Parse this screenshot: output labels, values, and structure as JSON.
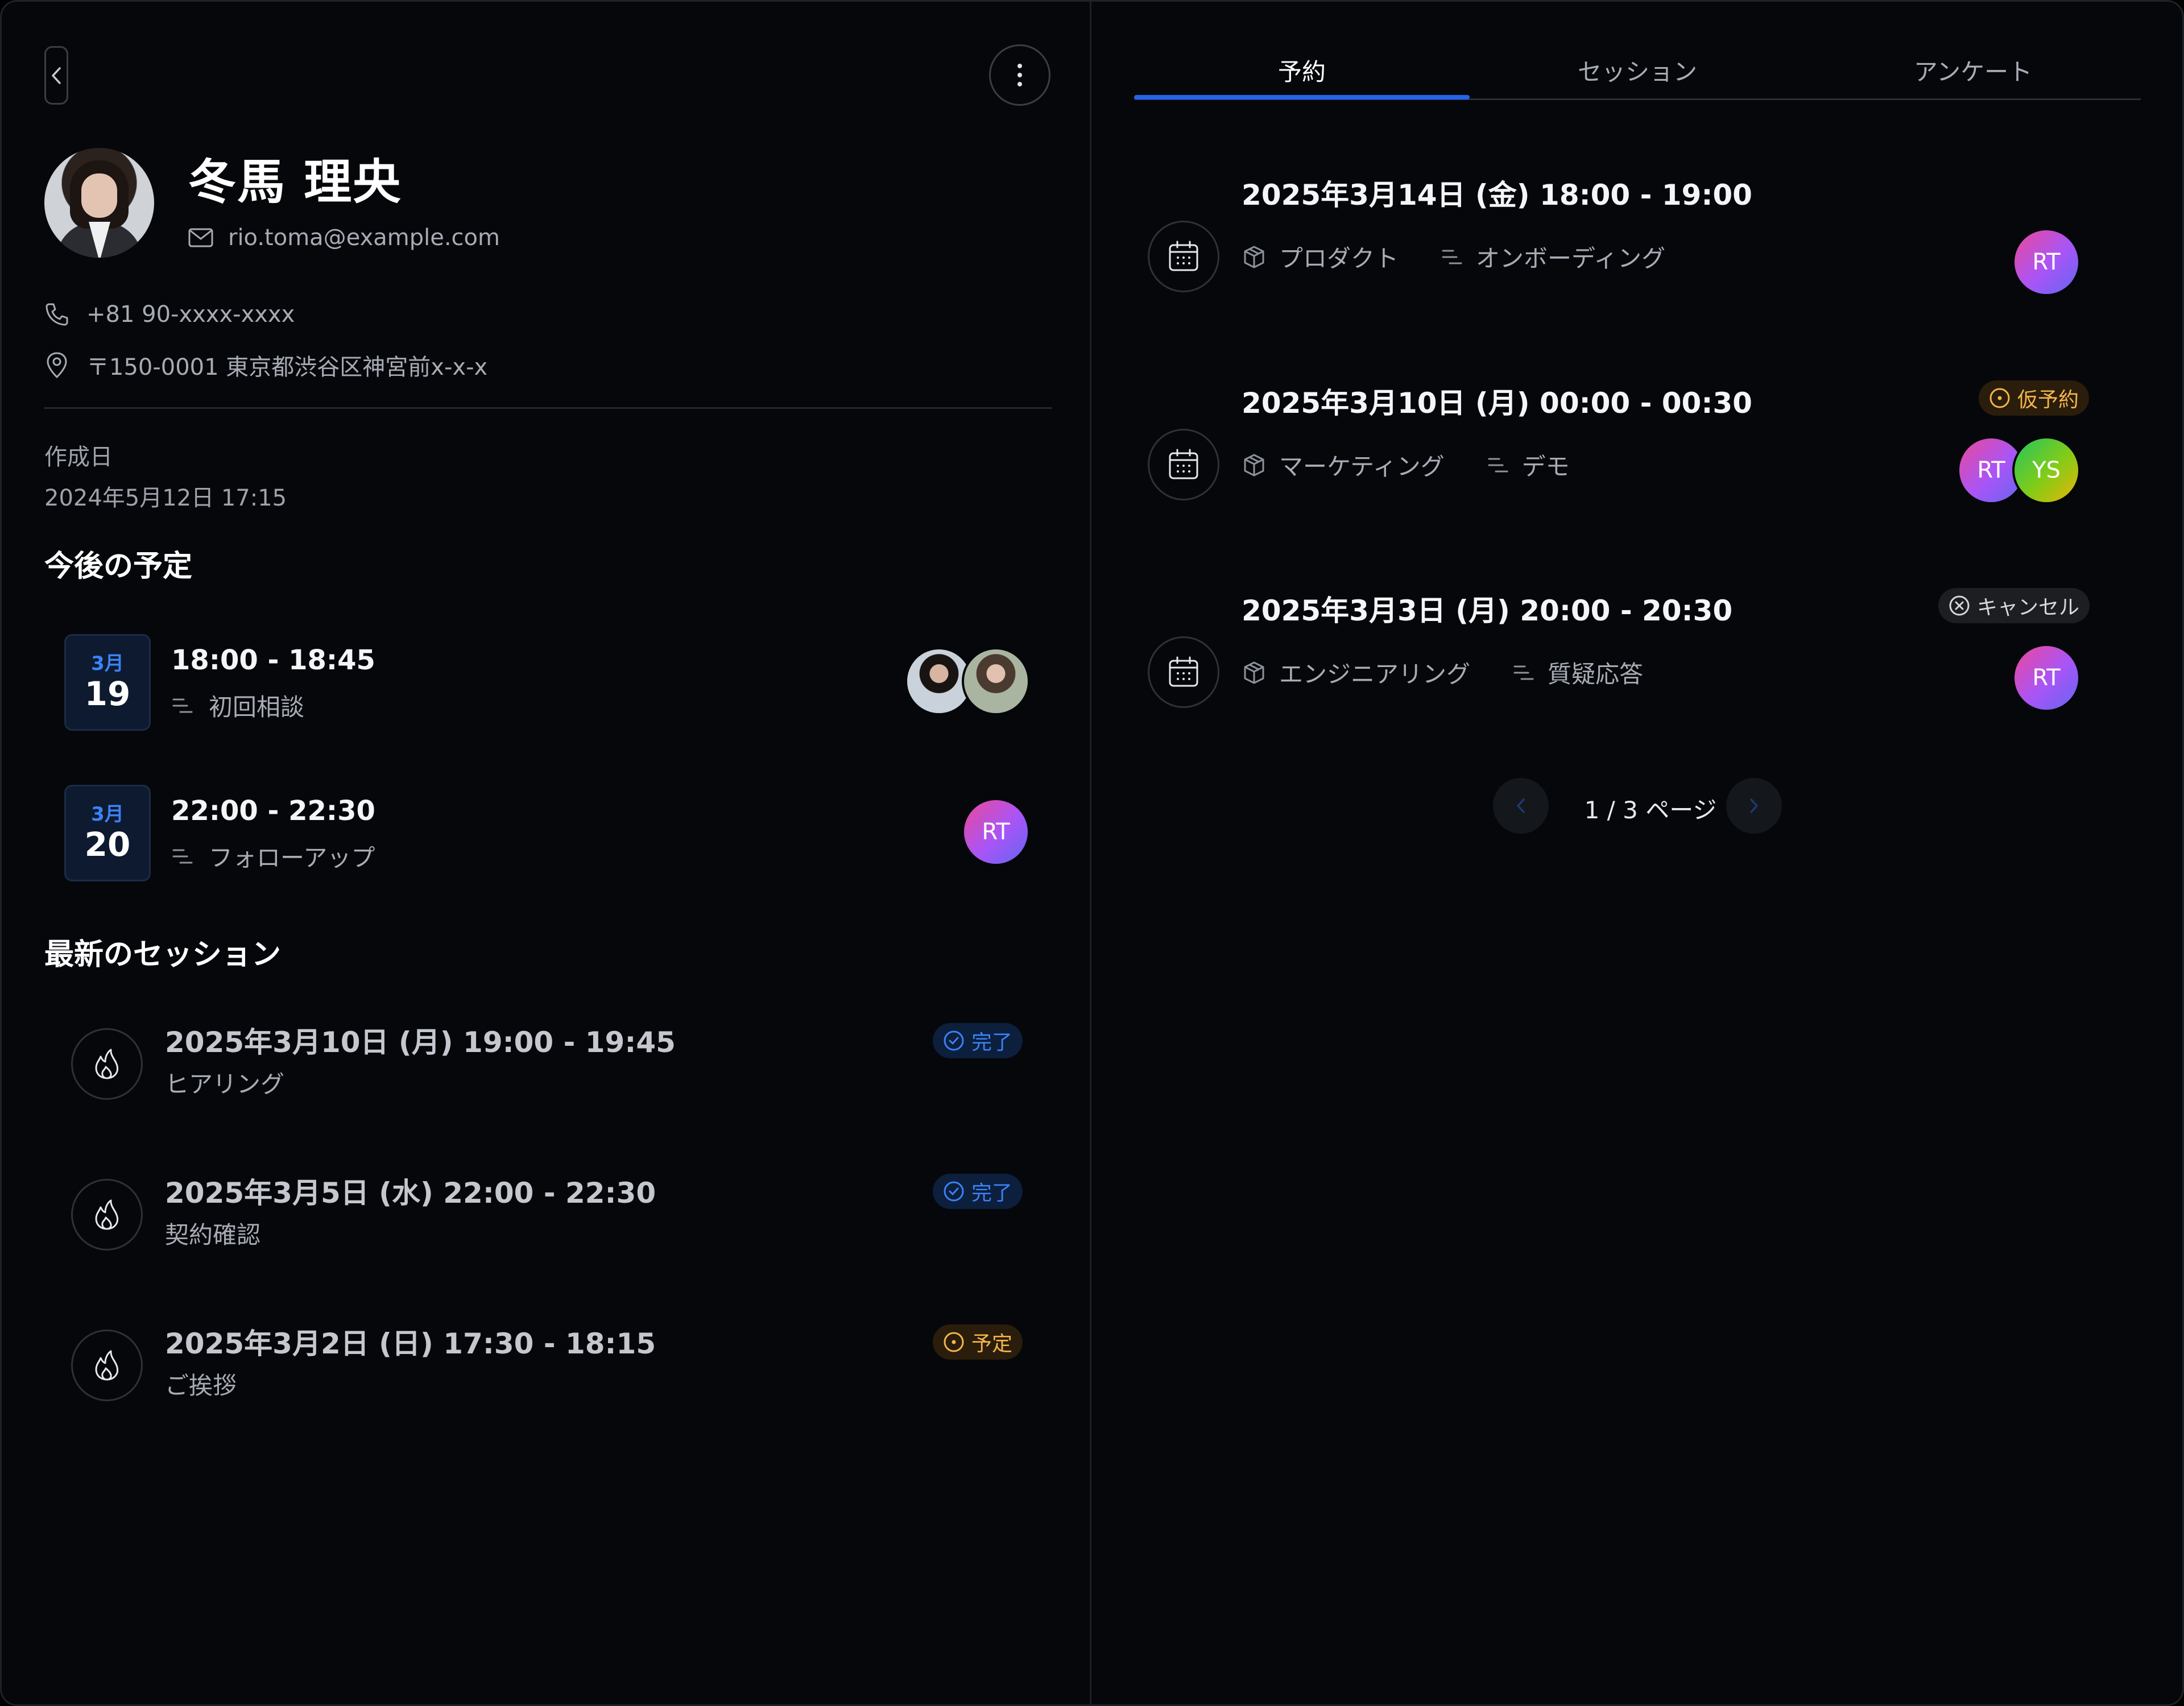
{
  "profile": {
    "name": "冬馬 理央",
    "email": "rio.toma@example.com",
    "phone": "+81 90-xxxx-xxxx",
    "address": "〒150-0001 東京都渋谷区神宮前x-x-x",
    "created_label": "作成日",
    "created_value": "2024年5月12日 17:15"
  },
  "upcoming": {
    "title": "今後の予定",
    "items": [
      {
        "month": "3月",
        "day": "19",
        "time": "18:00 - 18:45",
        "label": "初回相談"
      },
      {
        "month": "3月",
        "day": "20",
        "time": "22:00 - 22:30",
        "label": "フォローアップ",
        "avatar": "RT"
      }
    ]
  },
  "sessions": {
    "title": "最新のセッション",
    "items": [
      {
        "title": "2025年3月10日 (月) 19:00 - 19:45",
        "sub": "ヒアリング",
        "badge": "完了"
      },
      {
        "title": "2025年3月5日 (水) 22:00 - 22:30",
        "sub": "契約確認",
        "badge": "完了"
      },
      {
        "title": "2025年3月2日 (日) 17:30 - 18:15",
        "sub": "ご挨拶",
        "badge": "予定"
      }
    ]
  },
  "tabs": [
    {
      "label": "予約",
      "active": true
    },
    {
      "label": "セッション",
      "active": false
    },
    {
      "label": "アンケート",
      "active": false
    }
  ],
  "bookings": [
    {
      "title": "2025年3月14日 (金) 18:00 - 19:00",
      "product": "プロダクト",
      "type": "オンボーディング",
      "avatars": [
        "RT"
      ]
    },
    {
      "title": "2025年3月10日 (月) 00:00 - 00:30",
      "product": "マーケティング",
      "type": "デモ",
      "badge": "仮予約",
      "avatars": [
        "RT",
        "YS"
      ]
    },
    {
      "title": "2025年3月3日 (月) 20:00 - 20:30",
      "product": "エンジニアリング",
      "type": "質疑応答",
      "badge": "キャンセル",
      "avatars": [
        "RT"
      ]
    }
  ],
  "pagination": {
    "text": "1 / 3 ページ"
  },
  "colors": {
    "accent": "#2563eb",
    "done": "#3b82f6",
    "pending": "#f3b54a",
    "background": "#05070b"
  },
  "icons": [
    "chevron-left-icon",
    "more-vertical-icon",
    "mail-icon",
    "phone-icon",
    "map-pin-icon",
    "list-icon",
    "flame-icon",
    "calendar-icon",
    "box-icon",
    "check-circle-icon",
    "clock-circle-icon",
    "x-circle-icon",
    "chevron-right-icon"
  ]
}
